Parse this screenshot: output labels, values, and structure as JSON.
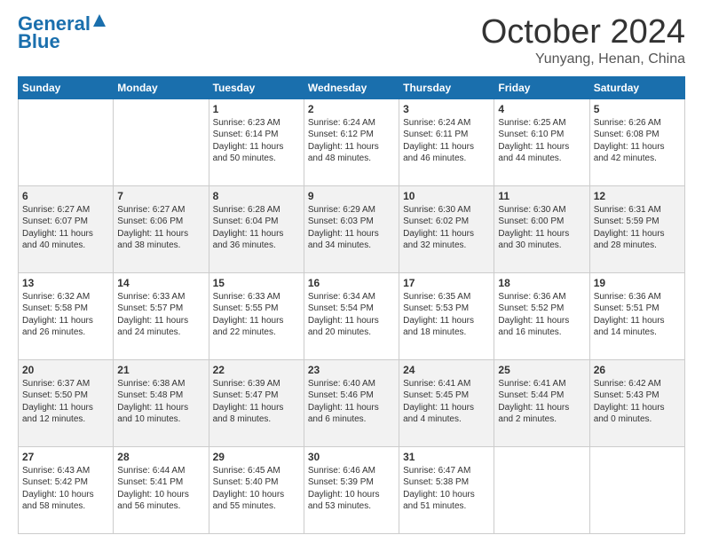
{
  "header": {
    "logo_line1": "General",
    "logo_line2": "Blue",
    "month_title": "October 2024",
    "location": "Yunyang, Henan, China"
  },
  "days_of_week": [
    "Sunday",
    "Monday",
    "Tuesday",
    "Wednesday",
    "Thursday",
    "Friday",
    "Saturday"
  ],
  "weeks": [
    [
      {
        "day": "",
        "info": ""
      },
      {
        "day": "",
        "info": ""
      },
      {
        "day": "1",
        "info": "Sunrise: 6:23 AM\nSunset: 6:14 PM\nDaylight: 11 hours and 50 minutes."
      },
      {
        "day": "2",
        "info": "Sunrise: 6:24 AM\nSunset: 6:12 PM\nDaylight: 11 hours and 48 minutes."
      },
      {
        "day": "3",
        "info": "Sunrise: 6:24 AM\nSunset: 6:11 PM\nDaylight: 11 hours and 46 minutes."
      },
      {
        "day": "4",
        "info": "Sunrise: 6:25 AM\nSunset: 6:10 PM\nDaylight: 11 hours and 44 minutes."
      },
      {
        "day": "5",
        "info": "Sunrise: 6:26 AM\nSunset: 6:08 PM\nDaylight: 11 hours and 42 minutes."
      }
    ],
    [
      {
        "day": "6",
        "info": "Sunrise: 6:27 AM\nSunset: 6:07 PM\nDaylight: 11 hours and 40 minutes."
      },
      {
        "day": "7",
        "info": "Sunrise: 6:27 AM\nSunset: 6:06 PM\nDaylight: 11 hours and 38 minutes."
      },
      {
        "day": "8",
        "info": "Sunrise: 6:28 AM\nSunset: 6:04 PM\nDaylight: 11 hours and 36 minutes."
      },
      {
        "day": "9",
        "info": "Sunrise: 6:29 AM\nSunset: 6:03 PM\nDaylight: 11 hours and 34 minutes."
      },
      {
        "day": "10",
        "info": "Sunrise: 6:30 AM\nSunset: 6:02 PM\nDaylight: 11 hours and 32 minutes."
      },
      {
        "day": "11",
        "info": "Sunrise: 6:30 AM\nSunset: 6:00 PM\nDaylight: 11 hours and 30 minutes."
      },
      {
        "day": "12",
        "info": "Sunrise: 6:31 AM\nSunset: 5:59 PM\nDaylight: 11 hours and 28 minutes."
      }
    ],
    [
      {
        "day": "13",
        "info": "Sunrise: 6:32 AM\nSunset: 5:58 PM\nDaylight: 11 hours and 26 minutes."
      },
      {
        "day": "14",
        "info": "Sunrise: 6:33 AM\nSunset: 5:57 PM\nDaylight: 11 hours and 24 minutes."
      },
      {
        "day": "15",
        "info": "Sunrise: 6:33 AM\nSunset: 5:55 PM\nDaylight: 11 hours and 22 minutes."
      },
      {
        "day": "16",
        "info": "Sunrise: 6:34 AM\nSunset: 5:54 PM\nDaylight: 11 hours and 20 minutes."
      },
      {
        "day": "17",
        "info": "Sunrise: 6:35 AM\nSunset: 5:53 PM\nDaylight: 11 hours and 18 minutes."
      },
      {
        "day": "18",
        "info": "Sunrise: 6:36 AM\nSunset: 5:52 PM\nDaylight: 11 hours and 16 minutes."
      },
      {
        "day": "19",
        "info": "Sunrise: 6:36 AM\nSunset: 5:51 PM\nDaylight: 11 hours and 14 minutes."
      }
    ],
    [
      {
        "day": "20",
        "info": "Sunrise: 6:37 AM\nSunset: 5:50 PM\nDaylight: 11 hours and 12 minutes."
      },
      {
        "day": "21",
        "info": "Sunrise: 6:38 AM\nSunset: 5:48 PM\nDaylight: 11 hours and 10 minutes."
      },
      {
        "day": "22",
        "info": "Sunrise: 6:39 AM\nSunset: 5:47 PM\nDaylight: 11 hours and 8 minutes."
      },
      {
        "day": "23",
        "info": "Sunrise: 6:40 AM\nSunset: 5:46 PM\nDaylight: 11 hours and 6 minutes."
      },
      {
        "day": "24",
        "info": "Sunrise: 6:41 AM\nSunset: 5:45 PM\nDaylight: 11 hours and 4 minutes."
      },
      {
        "day": "25",
        "info": "Sunrise: 6:41 AM\nSunset: 5:44 PM\nDaylight: 11 hours and 2 minutes."
      },
      {
        "day": "26",
        "info": "Sunrise: 6:42 AM\nSunset: 5:43 PM\nDaylight: 11 hours and 0 minutes."
      }
    ],
    [
      {
        "day": "27",
        "info": "Sunrise: 6:43 AM\nSunset: 5:42 PM\nDaylight: 10 hours and 58 minutes."
      },
      {
        "day": "28",
        "info": "Sunrise: 6:44 AM\nSunset: 5:41 PM\nDaylight: 10 hours and 56 minutes."
      },
      {
        "day": "29",
        "info": "Sunrise: 6:45 AM\nSunset: 5:40 PM\nDaylight: 10 hours and 55 minutes."
      },
      {
        "day": "30",
        "info": "Sunrise: 6:46 AM\nSunset: 5:39 PM\nDaylight: 10 hours and 53 minutes."
      },
      {
        "day": "31",
        "info": "Sunrise: 6:47 AM\nSunset: 5:38 PM\nDaylight: 10 hours and 51 minutes."
      },
      {
        "day": "",
        "info": ""
      },
      {
        "day": "",
        "info": ""
      }
    ]
  ]
}
